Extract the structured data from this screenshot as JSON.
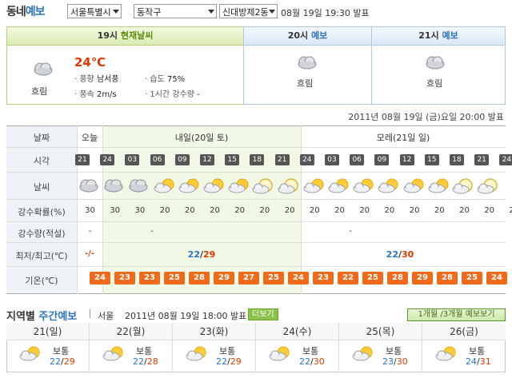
{
  "header": {
    "title_part1": "동네",
    "title_part2": "예보",
    "selects": [
      "서울특별시",
      "동작구",
      "신대방제2동"
    ],
    "issued": "08월 19일 19:30 발표"
  },
  "current": {
    "header_time": "19시",
    "header_label": "현재날씨",
    "condition": "흐림",
    "temp": "24℃",
    "wind_dir_label": "풍향",
    "wind_dir": "남서풍",
    "wind_speed_label": "풍속",
    "wind_speed": "2m/s",
    "humidity_label": "습도",
    "humidity": "75%",
    "rain_label": "1시간 강수량",
    "rain": "-"
  },
  "forecasts": [
    {
      "time": "20시",
      "label": "예보",
      "condition": "흐림"
    },
    {
      "time": "21시",
      "label": "예보",
      "condition": "흐림"
    }
  ],
  "timestamp": "2011년 08월 19일 (금)요일 20:00 발표",
  "table": {
    "labels": {
      "date": "날짜",
      "hour": "시각",
      "weather": "날씨",
      "pop": "강수확률(%)",
      "rain": "강수량(적설)",
      "minmax": "최저/최고(℃)",
      "temp": "기온(℃)"
    },
    "days": [
      "오늘",
      "내일(20일 토)",
      "모레(21일 일)"
    ],
    "hours": [
      "21",
      "24",
      "03",
      "06",
      "09",
      "12",
      "15",
      "18",
      "21",
      "24",
      "03",
      "06",
      "09",
      "12",
      "15",
      "18",
      "21",
      "24"
    ],
    "pop": [
      "30",
      "30",
      "30",
      "20",
      "20",
      "20",
      "20",
      "20",
      "20",
      "20",
      "20",
      "20",
      "20",
      "20",
      "20",
      "20",
      "20",
      "20"
    ],
    "rain": [
      "-",
      "-",
      "-"
    ],
    "minmax_today": "-/-",
    "minmax_tomorrow_min": "22",
    "minmax_tomorrow_max": "29",
    "minmax_after_min": "22",
    "minmax_after_max": "30",
    "temps": [
      "24",
      "23",
      "23",
      "25",
      "28",
      "29",
      "27",
      "25",
      "24",
      "23",
      "22",
      "25",
      "28",
      "29",
      "28",
      "25",
      "24"
    ]
  },
  "weekly": {
    "title_part1": "지역별",
    "title_part2": "주간예보",
    "region": "서울",
    "issued": "2011년 08월 19일 18:00 발표",
    "more_button": "더보기",
    "monthly_button": "1개월 /3개월 예보보기",
    "days": [
      {
        "day": "21(일)",
        "condition": "보통",
        "min": "22",
        "max": "29"
      },
      {
        "day": "22(월)",
        "condition": "보통",
        "min": "22",
        "max": "28"
      },
      {
        "day": "23(화)",
        "condition": "보통",
        "min": "22",
        "max": "29"
      },
      {
        "day": "24(수)",
        "condition": "보통",
        "min": "22",
        "max": "30"
      },
      {
        "day": "25(목)",
        "condition": "보통",
        "min": "23",
        "max": "30"
      },
      {
        "day": "26(금)",
        "condition": "보통",
        "min": "24",
        "max": "31"
      }
    ]
  },
  "colors": {
    "blue": "#2b73c6",
    "green": "#5a8a0e",
    "orange": "#f06a1a",
    "red": "#e03a00"
  }
}
